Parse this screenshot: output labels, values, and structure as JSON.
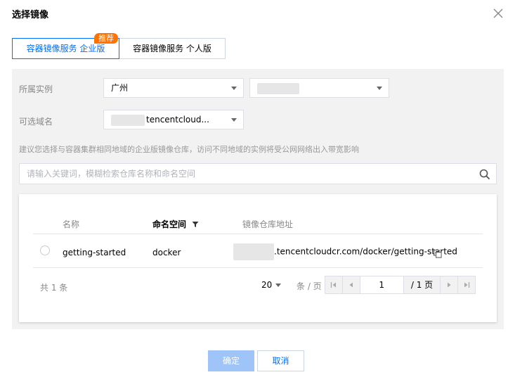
{
  "dialog": {
    "title": "选择镜像"
  },
  "tabs": [
    {
      "label": "容器镜像服务 企业版",
      "badge": "推荐",
      "active": true
    },
    {
      "label": "容器镜像服务 个人版",
      "active": false
    }
  ],
  "filters": {
    "instance_label": "所属实例",
    "region_value": "广州",
    "instance_value": "",
    "domain_label": "可选域名",
    "domain_value": "tencentcloud..."
  },
  "hint": "建议您选择与容器集群相同地域的企业版镜像仓库，访问不同地域的实例将受公网网络出入带宽影响",
  "search": {
    "placeholder": "请输入关键词，模糊检索仓库名称和命名空间"
  },
  "table": {
    "columns": [
      "名称",
      "命名空间",
      "镜像仓库地址"
    ],
    "rows": [
      {
        "name": "getting-started",
        "namespace": "docker",
        "address": ".tencentcloudcr.com/docker/getting-started"
      }
    ]
  },
  "pagination": {
    "total": "共 1 条",
    "page_size": "20",
    "page_size_unit": "条 / 页",
    "current_page": "1",
    "total_pages": "/ 1 页"
  },
  "footer": {
    "confirm": "确定",
    "cancel": "取消"
  },
  "colors": {
    "accent": "#006eff",
    "badge": "#ff7200",
    "confirm_disabled": "#9fc5f8"
  },
  "icons": [
    "close-icon",
    "search-icon",
    "filter-icon",
    "copy-icon",
    "first-page-icon",
    "prev-page-icon",
    "next-page-icon",
    "last-page-icon"
  ]
}
